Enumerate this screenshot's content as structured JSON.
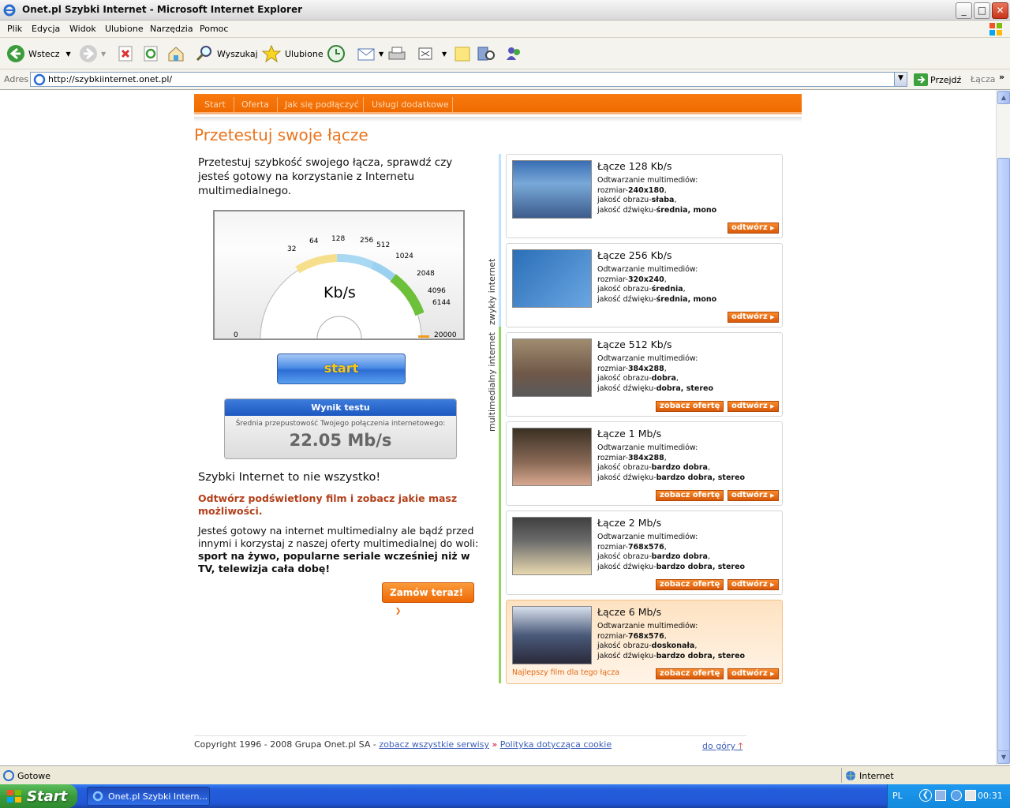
{
  "window": {
    "title": "Onet.pl Szybki Internet - Microsoft Internet Explorer",
    "min": "_",
    "max": "□",
    "close": "✕"
  },
  "menu": [
    "Plik",
    "Edycja",
    "Widok",
    "Ulubione",
    "Narzędzia",
    "Pomoc"
  ],
  "toolbar": {
    "back": "Wstecz",
    "search": "Wyszukaj",
    "favorites": "Ulubione"
  },
  "address": {
    "label": "Adres",
    "url": "http://szybkiinternet.onet.pl/",
    "go": "Przejdź",
    "links": "Łącza"
  },
  "nav": [
    "Start",
    "Oferta",
    "Jak się podłączyć",
    "Usługi dodatkowe"
  ],
  "page": {
    "heading": "Przetestuj swoje łącze",
    "intro": "Przetestuj szybkość swojego łącza, sprawdź czy jesteś gotowy na korzystanie z Internetu multimedialnego.",
    "gauge": {
      "unit": "Kb/s",
      "ticks": [
        "0",
        "32",
        "64",
        "128",
        "256",
        "512",
        "1024",
        "2048",
        "4096",
        "6144",
        "20000"
      ]
    },
    "start_button": "start",
    "result": {
      "title": "Wynik testu",
      "label": "Średnia przepustowość Twojego połączenia internetowego:",
      "value": "22.05 Mb/s"
    },
    "subheading": "Szybki Internet to nie wszystko!",
    "promo": "Odtwórz podświetlony film i zobacz jakie masz możliwości.",
    "para_plain": "Jesteś gotowy na internet multimedialny ale bądź przed innymi i korzystaj z naszej oferty multimedialnej do woli: ",
    "para_bold": "sport na żywo, popularne seriale wcześniej niż w TV, telewizja cała dobę!",
    "order_button": "Zamów teraz!",
    "side_labels": {
      "normal": "zwykły internet",
      "multimedia": "multimedialny internet"
    }
  },
  "cards": [
    {
      "title": "Łącze 128 Kb/s",
      "line1": "Odtwarzanie multimediów:",
      "size": "240x180",
      "quality": "słaba",
      "audio": "średnia, mono",
      "offer": false
    },
    {
      "title": "Łącze 256 Kb/s",
      "line1": "Odtwarzanie multimediów:",
      "size": "320x240",
      "quality": "średnia",
      "audio": "średnia, mono",
      "offer": false
    },
    {
      "title": "Łącze 512 Kb/s",
      "line1": "Odtwarzanie multimediów:",
      "size": "384x288",
      "quality": "dobra",
      "audio": "dobra, stereo",
      "offer": true
    },
    {
      "title": "Łącze 1 Mb/s",
      "line1": "Odtwarzanie multimediów:",
      "size": "384x288",
      "quality": "bardzo dobra",
      "audio": "bardzo dobra, stereo",
      "offer": true
    },
    {
      "title": "Łącze 2 Mb/s",
      "line1": "Odtwarzanie multimediów:",
      "size": "768x576",
      "quality": "bardzo dobra",
      "audio": "bardzo dobra, stereo",
      "offer": true
    },
    {
      "title": "Łącze 6 Mb/s",
      "line1": "Odtwarzanie multimediów:",
      "size": "768x576",
      "quality": "doskonała",
      "audio": "bardzo dobra, stereo",
      "offer": true,
      "best": "Najlepszy film dla tego łącza"
    }
  ],
  "card_labels": {
    "size": "rozmiar-",
    "quality": "jakość obrazu-",
    "audio": "jakość dźwięku-",
    "play": "odtwórz",
    "offer": "zobacz ofertę"
  },
  "footer": {
    "copyright": "Copyright 1996 - 2008 Grupa Onet.pl SA - ",
    "all_services": "zobacz wszystkie serwisy",
    "arrows": "»",
    "cookie": "Polityka dotycząca cookie",
    "top": "do góry"
  },
  "status": {
    "text": "Gotowe",
    "zone": "Internet"
  },
  "taskbar": {
    "start": "Start",
    "item": "Onet.pl Szybki Intern...",
    "lang": "PL",
    "time": "00:31"
  }
}
